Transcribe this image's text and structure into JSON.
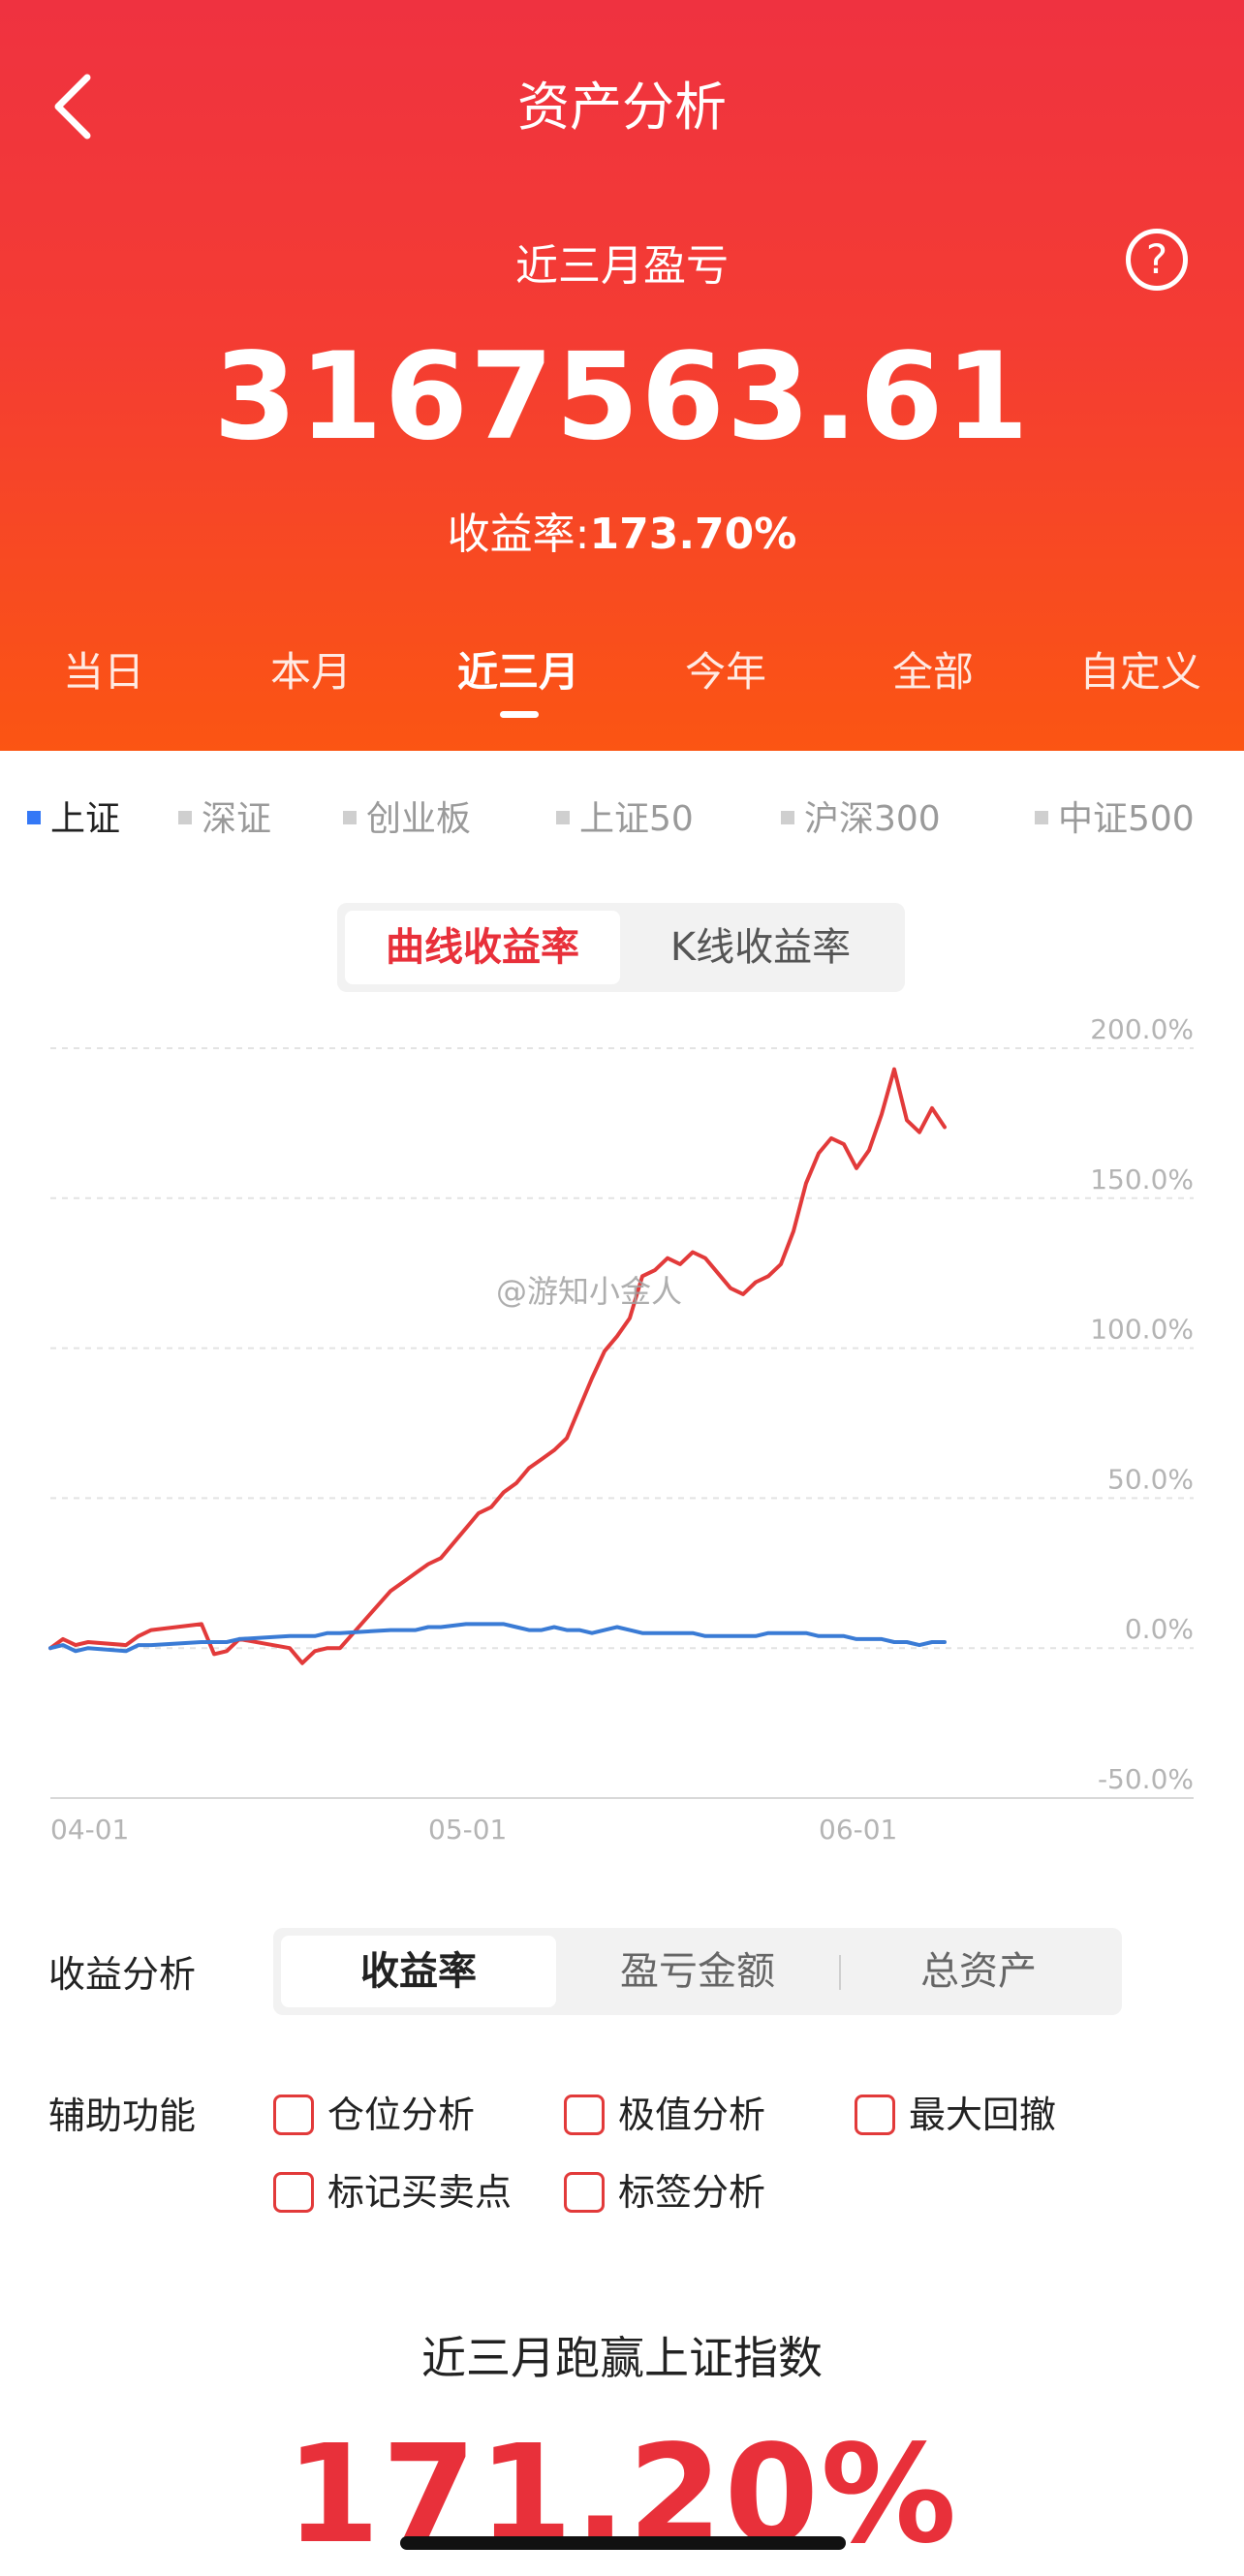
{
  "header": {
    "title": "资产分析",
    "period_title": "近三月盈亏",
    "profit_amount": "3167563.61",
    "return_label": "收益率:",
    "return_value": "173.70%",
    "help_symbol": "?"
  },
  "range_tabs": [
    "当日",
    "本月",
    "近三月",
    "今年",
    "全部",
    "自定义"
  ],
  "active_range": "近三月",
  "index_tabs": [
    "上证",
    "深证",
    "创业板",
    "上证50",
    "沪深300",
    "中证500"
  ],
  "active_index": "上证",
  "chart_mode": {
    "curve": "曲线收益率",
    "kline": "K线收益率"
  },
  "watermark": "@游知小金人",
  "chart_data": {
    "type": "line",
    "title": "",
    "y_axis": {
      "ticks": [
        "200.0%",
        "150.0%",
        "100.0%",
        "50.0%",
        "0.0%",
        "-50.0%"
      ],
      "range": [
        -50,
        200
      ],
      "unit": "%",
      "position": "right"
    },
    "x_axis": {
      "ticks": [
        "04-01",
        "05-01",
        "06-01"
      ]
    },
    "grid": true,
    "series": [
      {
        "color": "#e23a3a",
        "x": [
          0,
          1,
          2,
          3,
          6,
          7,
          8,
          12,
          13,
          14,
          15,
          19,
          20,
          21,
          22,
          23,
          27,
          28,
          29,
          30,
          31,
          33,
          34,
          35,
          36,
          37,
          38,
          39,
          40,
          41,
          42,
          43,
          44,
          45,
          46,
          47,
          48,
          49,
          50,
          51,
          52,
          53,
          54,
          55,
          56,
          57,
          58,
          59,
          60,
          61,
          62,
          63,
          64,
          65,
          66,
          67,
          68,
          69,
          70,
          71
        ],
        "y": [
          0,
          3,
          1,
          2,
          1,
          4,
          6,
          8,
          -2,
          -1,
          3,
          0,
          -5,
          -1,
          0,
          0,
          19,
          22,
          25,
          28,
          30,
          40,
          45,
          47,
          52,
          55,
          60,
          63,
          66,
          70,
          80,
          90,
          99,
          104,
          110,
          124,
          126,
          130,
          128,
          132,
          130,
          125,
          120,
          118,
          122,
          124,
          128,
          139,
          155,
          165,
          170,
          168,
          160,
          166,
          178,
          193,
          176,
          172,
          180,
          173.7
        ]
      },
      {
        "color": "#3a7bd5",
        "x": [
          0,
          1,
          2,
          3,
          6,
          7,
          8,
          12,
          13,
          14,
          15,
          19,
          20,
          21,
          22,
          23,
          27,
          28,
          29,
          30,
          31,
          33,
          34,
          35,
          36,
          37,
          38,
          39,
          40,
          41,
          42,
          43,
          44,
          45,
          46,
          47,
          48,
          49,
          50,
          51,
          52,
          53,
          54,
          55,
          56,
          57,
          58,
          59,
          60,
          61,
          62,
          63,
          64,
          65,
          66,
          67,
          68,
          69,
          70,
          71
        ],
        "y": [
          0,
          1,
          -1,
          0,
          -1,
          1,
          1,
          2,
          2,
          2,
          3,
          4,
          4,
          4,
          5,
          5,
          6,
          6,
          6,
          7,
          7,
          8,
          8,
          8,
          8,
          7,
          6,
          6,
          7,
          6,
          6,
          5,
          6,
          7,
          6,
          5,
          5,
          5,
          5,
          5,
          4,
          4,
          4,
          4,
          4,
          5,
          5,
          5,
          5,
          4,
          4,
          4,
          3,
          3,
          3,
          2,
          2,
          1,
          2,
          2
        ]
      }
    ]
  },
  "analysis": {
    "label": "收益分析",
    "segments": [
      "收益率",
      "盈亏金额",
      "总资产"
    ],
    "active": "收益率"
  },
  "aux": {
    "label": "辅助功能",
    "options": [
      "仓位分析",
      "极值分析",
      "最大回撤",
      "标记买卖点",
      "标签分析"
    ]
  },
  "beat": {
    "title": "近三月跑赢上证指数",
    "value": "171.20%"
  }
}
